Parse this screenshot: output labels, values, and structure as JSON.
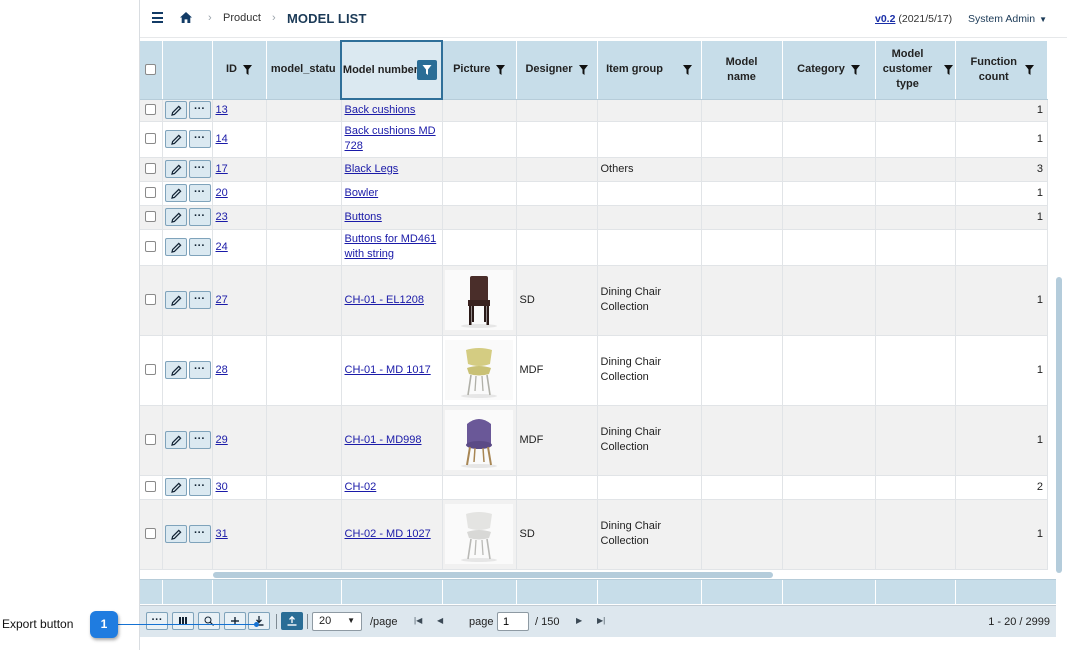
{
  "header": {
    "breadcrumb": [
      "Product"
    ],
    "page_title": "MODEL LIST",
    "version_link": "v0.2",
    "version_date": "(2021/5/17)",
    "user": "System Admin"
  },
  "grid": {
    "columns": [
      "ID",
      "model_statu",
      "Model number",
      "Picture",
      "Designer",
      "Item group",
      "Model name",
      "Category",
      "Model customer type",
      "Function count"
    ],
    "rows": [
      {
        "id": "13",
        "status": "",
        "model_number": "Back cushions",
        "picture": "",
        "designer": "",
        "item_group": "",
        "model_name": "",
        "category": "",
        "customer_type": "",
        "function_count": "1"
      },
      {
        "id": "14",
        "status": "",
        "model_number": "Back cushions MD 728",
        "picture": "",
        "designer": "",
        "item_group": "",
        "model_name": "",
        "category": "",
        "customer_type": "",
        "function_count": "1"
      },
      {
        "id": "17",
        "status": "",
        "model_number": "Black Legs",
        "picture": "",
        "designer": "",
        "item_group": "Others",
        "model_name": "",
        "category": "",
        "customer_type": "",
        "function_count": "3"
      },
      {
        "id": "20",
        "status": "",
        "model_number": "Bowler",
        "picture": "",
        "designer": "",
        "item_group": "",
        "model_name": "",
        "category": "",
        "customer_type": "",
        "function_count": "1"
      },
      {
        "id": "23",
        "status": "",
        "model_number": "Buttons",
        "picture": "",
        "designer": "",
        "item_group": "",
        "model_name": "",
        "category": "",
        "customer_type": "",
        "function_count": "1"
      },
      {
        "id": "24",
        "status": "",
        "model_number": "Buttons for MD461 with string",
        "picture": "",
        "designer": "",
        "item_group": "",
        "model_name": "",
        "category": "",
        "customer_type": "",
        "function_count": ""
      },
      {
        "id": "27",
        "status": "",
        "model_number": "CH-01 - EL1208",
        "picture": "dark-chair",
        "designer": "SD",
        "item_group": "Dining Chair Collection",
        "model_name": "",
        "category": "",
        "customer_type": "",
        "function_count": "1"
      },
      {
        "id": "28",
        "status": "",
        "model_number": "CH-01 - MD 1017",
        "picture": "yellow-chair",
        "designer": "MDF",
        "item_group": "Dining Chair Collection",
        "model_name": "",
        "category": "",
        "customer_type": "",
        "function_count": "1"
      },
      {
        "id": "29",
        "status": "",
        "model_number": "CH-01 - MD998",
        "picture": "purple-chair",
        "designer": "MDF",
        "item_group": "Dining Chair Collection",
        "model_name": "",
        "category": "",
        "customer_type": "",
        "function_count": "1"
      },
      {
        "id": "30",
        "status": "",
        "model_number": "CH-02",
        "picture": "",
        "designer": "",
        "item_group": "",
        "model_name": "",
        "category": "",
        "customer_type": "",
        "function_count": "2"
      },
      {
        "id": "31",
        "status": "",
        "model_number": "CH-02 - MD 1027",
        "picture": "white-chair",
        "designer": "SD",
        "item_group": "Dining Chair Collection",
        "model_name": "",
        "category": "",
        "customer_type": "",
        "function_count": "1"
      }
    ]
  },
  "pager": {
    "page_size": "20",
    "per_page_label": "/page",
    "page_label": "page",
    "current_page": "1",
    "total_pages": "/ 150",
    "range": "1 - 20 / 2999"
  },
  "callout": {
    "number": "1",
    "label": "Export button"
  },
  "colors": {
    "header_bg": "#c7dde9",
    "accent": "#2a6d96",
    "link": "#1a1aa8",
    "callout": "#1f7ce0"
  }
}
